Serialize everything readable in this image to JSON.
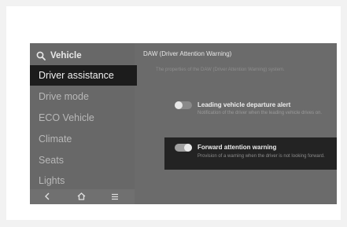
{
  "sidebar": {
    "title": "Vehicle",
    "items": [
      {
        "label": "Driver assistance",
        "active": true
      },
      {
        "label": "Drive mode",
        "active": false
      },
      {
        "label": "ECO Vehicle",
        "active": false
      },
      {
        "label": "Climate",
        "active": false
      },
      {
        "label": "Seats",
        "active": false
      },
      {
        "label": "Lights",
        "active": false
      }
    ],
    "nav": {
      "back": "<",
      "home": "home-icon",
      "menu": "≡"
    }
  },
  "main": {
    "title": "DAW (Driver Attention Warning)",
    "info": "The properties of the DAW (Driver Attention Warning) system.",
    "settings": [
      {
        "title": "Leading vehicle departure alert",
        "description": "Notification of the driver when the leading vehicle drives on.",
        "enabled": true,
        "highlighted": false
      },
      {
        "title": "Forward attention warning",
        "description": "Provision of a warning when the driver is not looking forward.",
        "enabled": true,
        "highlighted": true
      }
    ]
  },
  "colors": {
    "screen_bg": "#6b6b6b",
    "active_item_bg": "#1c1c1c",
    "highlight_bg": "#232323"
  }
}
